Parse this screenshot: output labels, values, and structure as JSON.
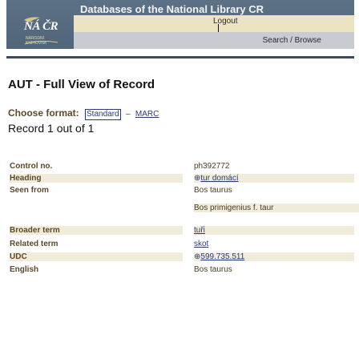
{
  "header": {
    "title": "Databases of the National Library CR",
    "logo_text": "NÁ ČR",
    "logo_sub": "NÁRODNÍ KNIHOVNA",
    "logout_label": "Logout",
    "search_browse_label": "Search / Browse"
  },
  "page": {
    "title": "AUT - Full View of Record",
    "format_label": "Choose format:",
    "format_standard": "Standard",
    "format_dash": "–",
    "format_marc": "MARC",
    "record_count": "Record 1 out of 1"
  },
  "record": {
    "control_label": "Control no.",
    "control_value": "ph392772",
    "heading_label": "Heading",
    "heading_value": "tur domácí",
    "seen_from_label": "Seen from",
    "seen_from_value_1": "Bos taurus",
    "seen_from_value_2": "Bos primigenius f. taur",
    "broader_label": "Broader term",
    "broader_value": "tuři",
    "related_label": "Related term",
    "related_value": "skot",
    "udc_label": "UDC",
    "udc_value": "599.735.511",
    "english_label": "English",
    "english_value": "Bos taurus"
  },
  "colors": {
    "banner": "#5d7186",
    "tan_bar": "#ece3c2",
    "gray_bar": "#c8ccd1",
    "label_brown": "#5a4a2a",
    "link_blue": "#2c3a70"
  }
}
